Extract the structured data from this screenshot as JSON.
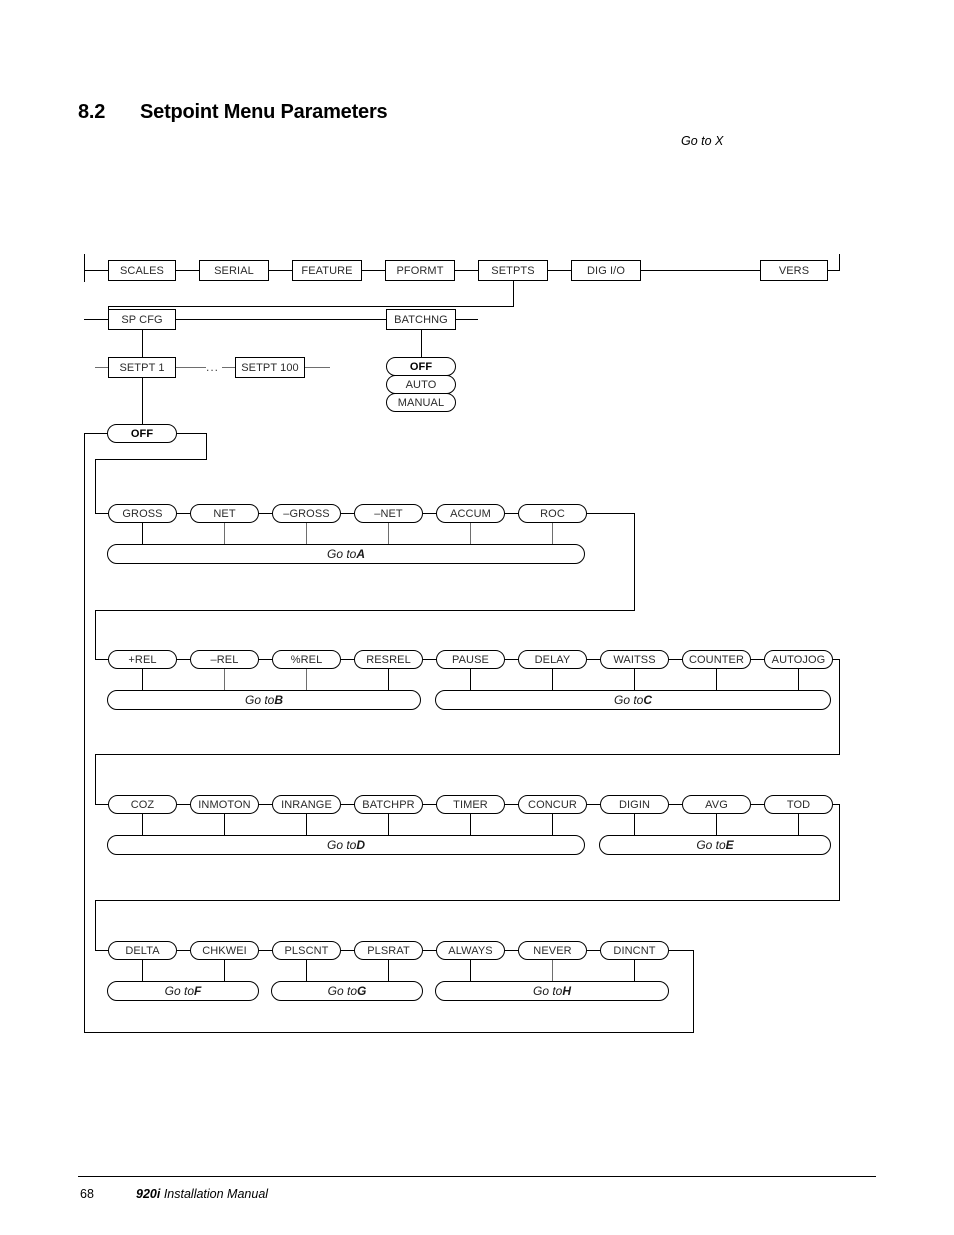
{
  "section": {
    "number": "8.2",
    "title": "Setpoint Menu Parameters"
  },
  "goto_x": "Go to X",
  "footer": {
    "page": "68",
    "manual_italic": "920i",
    "manual_rest": " Installation Manual"
  },
  "diagram": {
    "top_menu": [
      {
        "label": "SCALES"
      },
      {
        "label": "SERIAL"
      },
      {
        "label": "FEATURE"
      },
      {
        "label": "PFORMT"
      },
      {
        "label": "SETPTS"
      },
      {
        "label": "DIG I/O"
      },
      {
        "label": "VERS"
      }
    ],
    "level2": [
      {
        "label": "SP CFG"
      },
      {
        "label": "BATCHNG"
      }
    ],
    "setpoints": {
      "first": "SETPT 1",
      "ellipsis": "...",
      "last": "SETPT 100"
    },
    "batching_options": [
      {
        "label": "OFF",
        "bold": true
      },
      {
        "label": "AUTO",
        "bold": false
      },
      {
        "label": "MANUAL",
        "bold": false
      }
    ],
    "kind_default": {
      "label": "OFF",
      "bold": true
    },
    "rows": [
      {
        "id": "row-a",
        "nodes": [
          "GROSS",
          "NET",
          "–GROSS",
          "–NET",
          "ACCUM",
          "ROC"
        ],
        "gotos": [
          {
            "prefix": "Go to ",
            "letter": "A"
          }
        ]
      },
      {
        "id": "row-bc",
        "nodes": [
          "+REL",
          "–REL",
          "%REL",
          "RESREL",
          "PAUSE",
          "DELAY",
          "WAITSS",
          "COUNTER",
          "AUTOJOG"
        ],
        "gotos": [
          {
            "prefix": "Go to ",
            "letter": "B"
          },
          {
            "prefix": "Go to ",
            "letter": "C"
          }
        ]
      },
      {
        "id": "row-de",
        "nodes": [
          "COZ",
          "INMOTON",
          "INRANGE",
          "BATCHPR",
          "TIMER",
          "CONCUR",
          "DIGIN",
          "AVG",
          "TOD"
        ],
        "gotos": [
          {
            "prefix": "Go to ",
            "letter": "D"
          },
          {
            "prefix": "Go to ",
            "letter": "E"
          }
        ]
      },
      {
        "id": "row-fgh",
        "nodes": [
          "DELTA",
          "CHKWEI",
          "PLSCNT",
          "PLSRAT",
          "ALWAYS",
          "NEVER",
          "DINCNT"
        ],
        "gotos": [
          {
            "prefix": "Go to ",
            "letter": "F"
          },
          {
            "prefix": "Go to ",
            "letter": "G"
          },
          {
            "prefix": "Go to ",
            "letter": "H"
          }
        ]
      }
    ]
  }
}
